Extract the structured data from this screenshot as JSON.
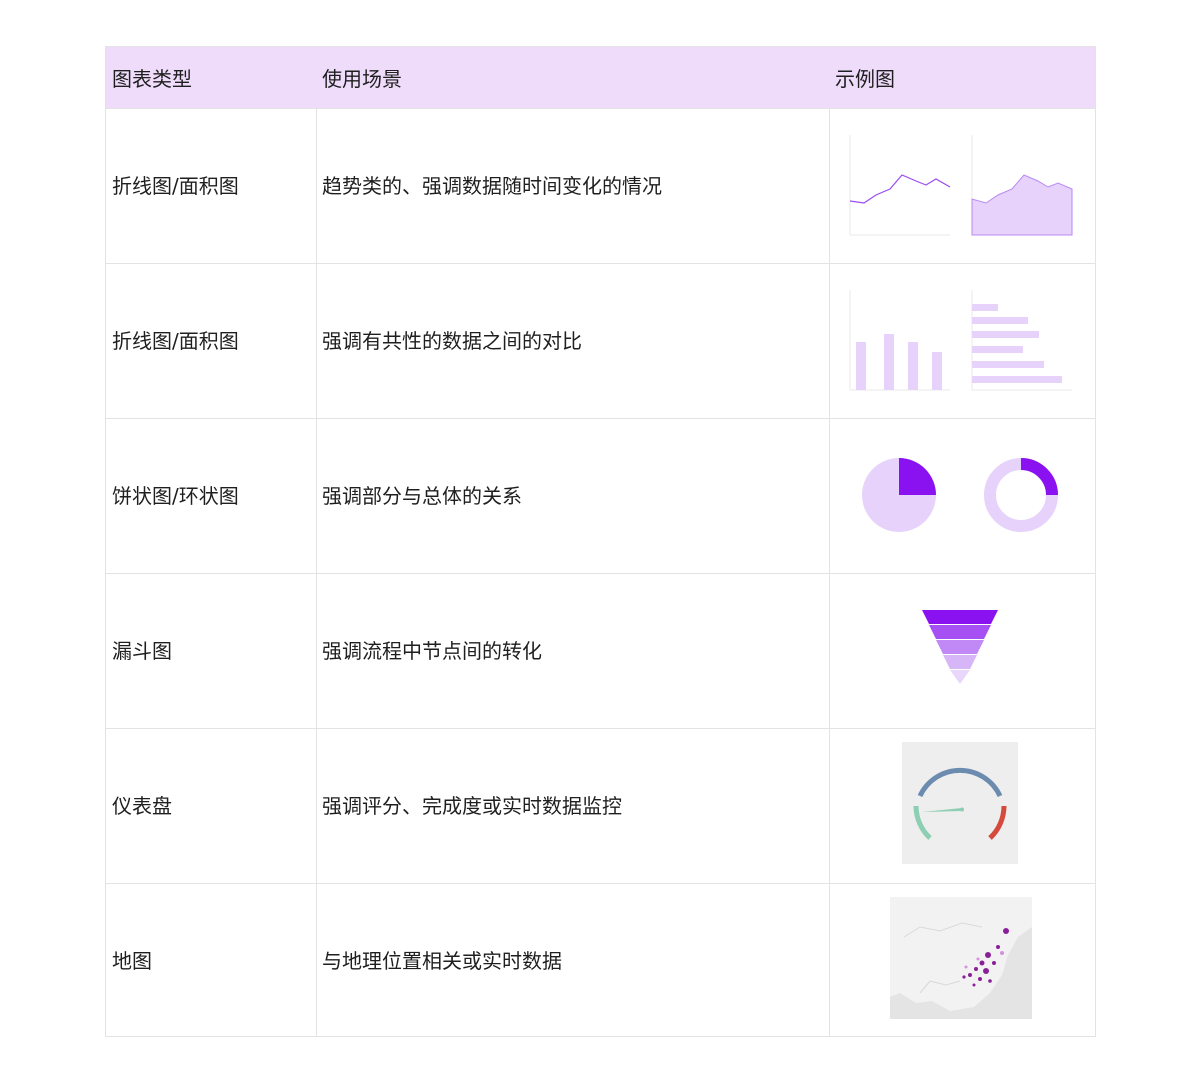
{
  "table": {
    "headers": [
      "图表类型",
      "使用场景",
      "示例图"
    ],
    "rows": [
      {
        "type": "折线图/面积图",
        "usage": "趋势类的、强调数据随时间变化的情况",
        "example": "line-area"
      },
      {
        "type": "折线图/面积图",
        "usage": "强调有共性的数据之间的对比",
        "example": "bar"
      },
      {
        "type": "饼状图/环状图",
        "usage": "强调部分与总体的关系",
        "example": "pie-donut"
      },
      {
        "type": "漏斗图",
        "usage": "强调流程中节点间的转化",
        "example": "funnel"
      },
      {
        "type": "仪表盘",
        "usage": "强调评分、完成度或实时数据监控",
        "example": "gauge"
      },
      {
        "type": "地图",
        "usage": "与地理位置相关或实时数据",
        "example": "map"
      }
    ]
  },
  "colors": {
    "header_bg": "#efdcfb",
    "accent": "#8a12f0",
    "accent_light": "#e6d2fb",
    "border": "#e3e3e3"
  }
}
